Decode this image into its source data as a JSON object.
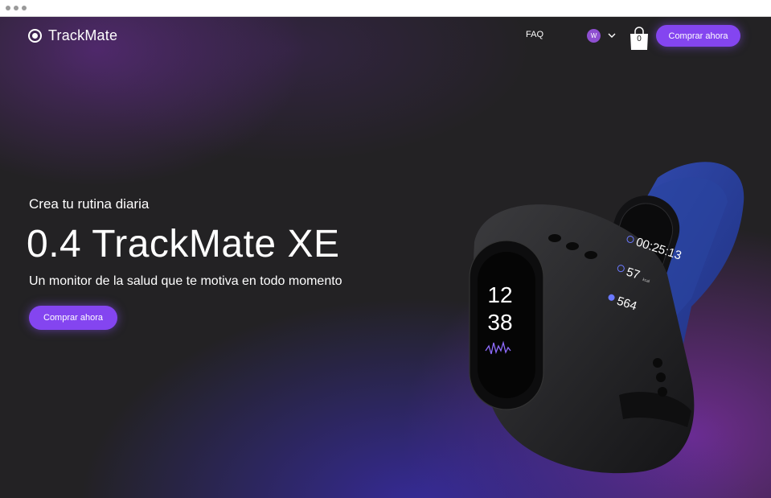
{
  "brand": {
    "name": "TrackMate"
  },
  "nav": {
    "faq_label": "FAQ",
    "avatar_initial": "W",
    "cart_count": "0",
    "cta_label": "Comprar ahora"
  },
  "hero": {
    "kicker": "Crea tu rutina diaria",
    "title": "0.4 TrackMate XE",
    "subtitle": "Un monitor de la salud que te motiva en todo momento",
    "cta_label": "Comprar ahora"
  },
  "device": {
    "black_band_hour": "12",
    "black_band_minute": "38",
    "blue_band_timer": "00:25:13",
    "blue_band_calories": "57",
    "blue_band_calories_unit": "kcal",
    "blue_band_steps": "564"
  },
  "colors": {
    "accent": "#8445f0",
    "background": "#232224",
    "band_black": "#1f1f21",
    "band_blue": "#243a8e"
  }
}
